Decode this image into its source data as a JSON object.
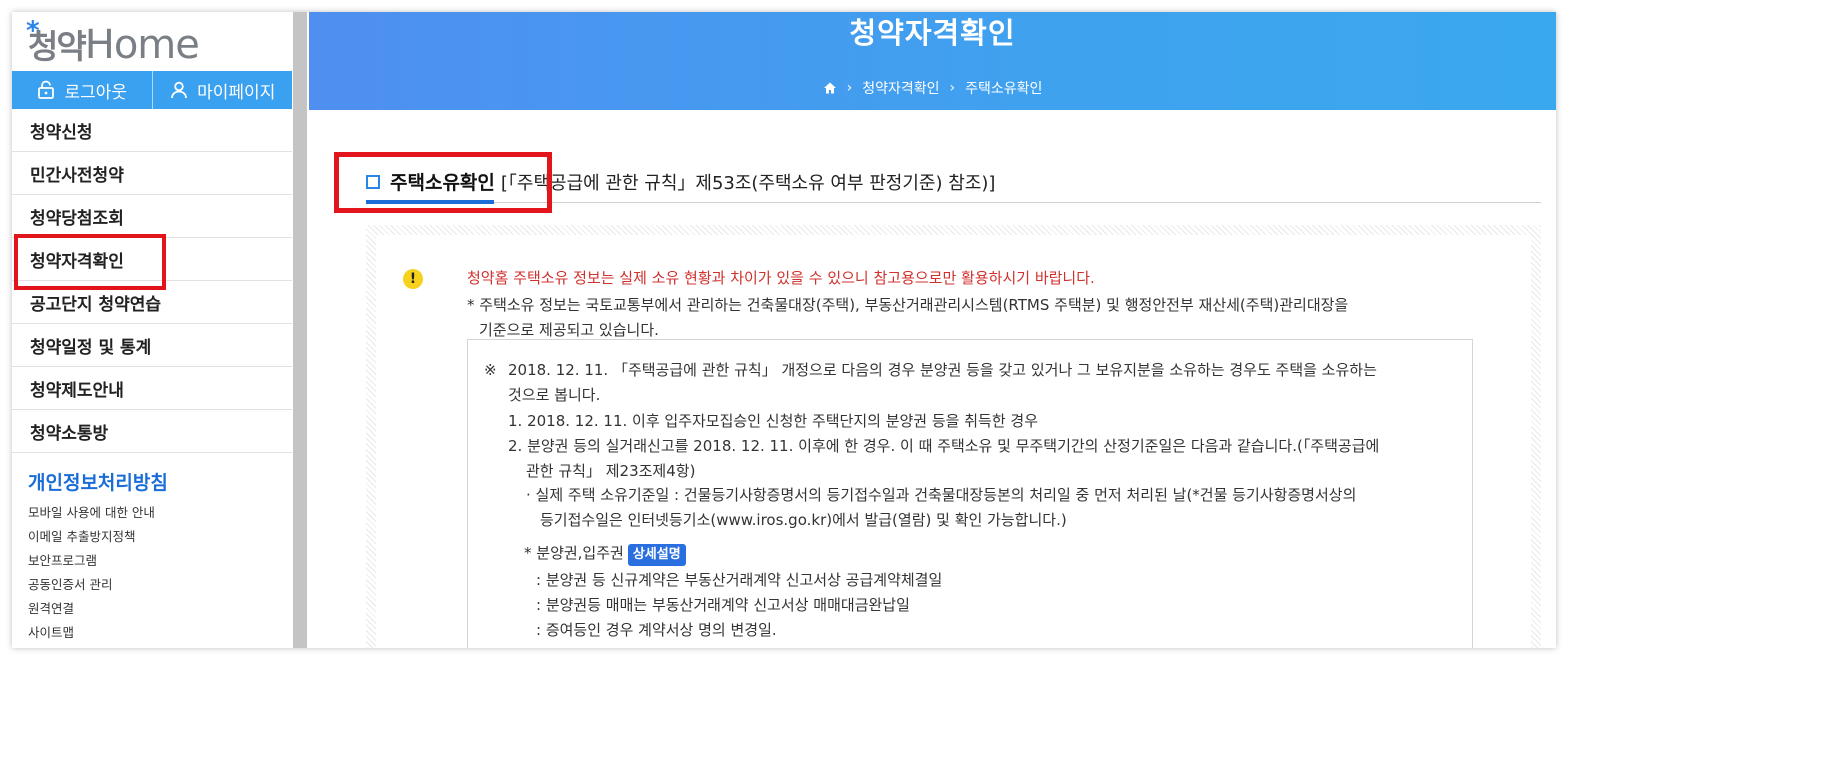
{
  "logo": {
    "ko": "청약",
    "en": "Home"
  },
  "auth": {
    "logout": "로그아웃",
    "mypage": "마이페이지"
  },
  "menu": [
    "청약신청",
    "민간사전청약",
    "청약당첨조회",
    "청약자격확인",
    "공고단지 청약연습",
    "청약일정 및 통계",
    "청약제도안내",
    "청약소통방"
  ],
  "side_sub": {
    "heading": "개인정보처리방침",
    "links": [
      "모바일 사용에 대한 안내",
      "이메일 추출방지정책",
      "보안프로그램",
      "공동인증서 관리",
      "원격연결",
      "사이트맵"
    ]
  },
  "hero": {
    "title": "청약자격확인",
    "breadcrumb": [
      "청약자격확인",
      "주택소유확인"
    ]
  },
  "section": {
    "title": "주택소유확인",
    "reference": "[「주택공급에 관한 규칙」제53조(주택소유 여부 판정기준) 참조)]"
  },
  "notice": {
    "warning": "청약홈 주택소유 정보는 실제 소유 현황과 차이가 있을 수 있으니 참고용으로만 활용하시기 바랍니다.",
    "star_line1": "* 주택소유 정보는 국토교통부에서 관리하는 건축물대장(주택), 부동산거래관리시스템(RTMS 주택분) 및 행정안전부 재산세(주택)관리대장을",
    "star_line2": "기준으로 제공되고 있습니다."
  },
  "rules": {
    "mark": "※",
    "intro1": "2018. 12. 11. 「주택공급에 관한 규칙」 개정으로 다음의 경우 분양권 등을 갖고 있거나 그 보유지분을 소유하는 경우도 주택을 소유하는",
    "intro2": "것으로 봅니다.",
    "item1": "1. 2018. 12. 11. 이후 입주자모집승인 신청한 주택단지의 분양권 등을 취득한 경우",
    "item2a": "2. 분양권 등의 실거래신고를 2018. 12. 11. 이후에 한 경우. 이 때 주택소유 및 무주택기간의 산정기준일은 다음과 같습니다.(「주택공급에",
    "item2b": "관한 규칙」 제23조제4항)",
    "bullet_a": "· 실제 주택 소유기준일 : 건물등기사항증명서의 등기접수일과 건축물대장등본의 처리일 중 먼저 처리된 날(*건물 등기사항증명서상의",
    "bullet_b": "등기접수일은 인터넷등기소(www.iros.go.kr)에서 발급(열람) 및 확인 가능합니다.)",
    "sub_head": "* 분양권,입주권",
    "badge": "상세설명",
    "sub1": ": 분양권 등 신규계약은 부동산거래계약 신고서상 공급계약체결일",
    "sub2": ": 분양권등 매매는 부동산거래계약 신고서상 매매대금완납일",
    "sub3": ": 증여등인 경우 계약서상 명의 변경일."
  },
  "colors": {
    "accent": "#3aa0f0",
    "highlight": "#e2141c",
    "warning": "#d0312d",
    "link": "#1a6dd8"
  }
}
